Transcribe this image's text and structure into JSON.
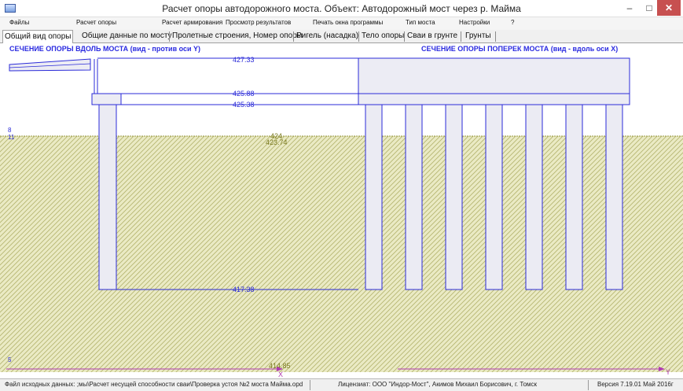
{
  "window": {
    "title": "Расчет опоры автодорожного моста.  Объект: Автодорожный мост через р. Майма",
    "minimize": "–",
    "maximize": "□",
    "close": "✕"
  },
  "menu": [
    "Файлы",
    "Расчет опоры",
    "Расчет армирования",
    "Просмотр результатов",
    "Печать окна программы",
    "Тип моста",
    "Настройки",
    "?"
  ],
  "tabs": [
    {
      "label": "Общий вид опоры",
      "active": true
    },
    {
      "label": "Общие данные по мосту",
      "active": false
    },
    {
      "label": "Пролетные строения, Номер опоры",
      "active": false
    },
    {
      "label": "Ригель (насадка)",
      "active": false
    },
    {
      "label": "Тело опоры",
      "active": false
    },
    {
      "label": "Сваи в грунте",
      "active": false
    },
    {
      "label": "Грунты",
      "active": false
    }
  ],
  "drawing": {
    "left_title": "СЕЧЕНИЕ ОПОРЫ ВДОЛЬ МОСТА (вид - против оси Y)",
    "right_title": "СЕЧЕНИЕ ОПОРЫ ПОПЕРЕК МОСТА (вид - вдоль оси X)",
    "elevations": {
      "top": "427.33",
      "cap_top": "425.88",
      "cap_bottom": "425.38",
      "ground_1": "424",
      "ground_2": "423.74",
      "pile_tip": "417.38",
      "bottom": "414.85"
    },
    "layer_marks": {
      "layer_top_num": "8",
      "layer_top_label": "11",
      "layer_bottom_label": "5"
    },
    "axes": {
      "x": "X",
      "y": "Y"
    },
    "colors": {
      "outline": "#2b2bd8",
      "soil_fill": "#eaeac4",
      "soil_hatch": "#b4b46e",
      "ground_text": "#7a7a20",
      "pile_fill": "#ebebf3"
    }
  },
  "status": {
    "file": "Файл исходных данных: ;мы\\Расчет несущей способности сваи\\Проверка устоя №2 моста Майма.opd",
    "licensee": "Лицензиат: ООО \"Индор-Мост\", Акимов Михаил Борисович, г. Томск",
    "version": "Версия 7.19.01 Май 2016г"
  }
}
